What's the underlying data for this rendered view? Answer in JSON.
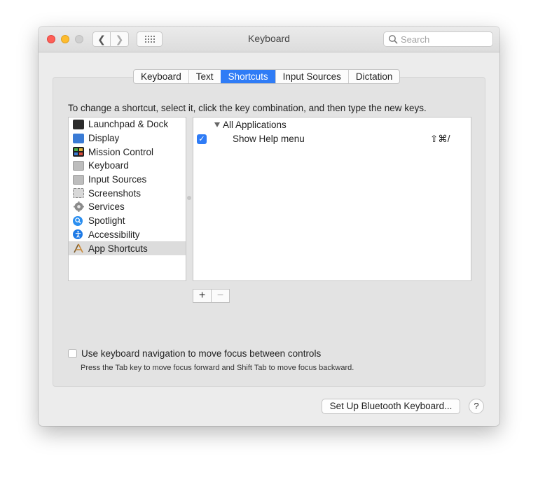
{
  "window": {
    "title": "Keyboard"
  },
  "toolbar": {
    "back_glyph": "❮",
    "forward_glyph": "❯",
    "search_placeholder": "Search"
  },
  "tabs": [
    {
      "label": "Keyboard",
      "active": false
    },
    {
      "label": "Text",
      "active": false
    },
    {
      "label": "Shortcuts",
      "active": true
    },
    {
      "label": "Input Sources",
      "active": false
    },
    {
      "label": "Dictation",
      "active": false
    }
  ],
  "instructions": "To change a shortcut, select it, click the key combination, and then type the new keys.",
  "categories": [
    {
      "label": "Launchpad & Dock",
      "icon": "launchpad-dock-icon",
      "color": "#2b2b2b"
    },
    {
      "label": "Display",
      "icon": "display-icon",
      "color": "#3a7bd5"
    },
    {
      "label": "Mission Control",
      "icon": "mission-control-icon",
      "color": "#1f1f1f"
    },
    {
      "label": "Keyboard",
      "icon": "keyboard-icon",
      "color": "#bdbdbd"
    },
    {
      "label": "Input Sources",
      "icon": "input-sources-icon",
      "color": "#bdbdbd"
    },
    {
      "label": "Screenshots",
      "icon": "screenshots-icon",
      "color": "#d8d8d8"
    },
    {
      "label": "Services",
      "icon": "services-gear-icon",
      "color": "#8a8a8a"
    },
    {
      "label": "Spotlight",
      "icon": "spotlight-icon",
      "color": "#2a8ef0"
    },
    {
      "label": "Accessibility",
      "icon": "accessibility-icon",
      "color": "#1e7ae6"
    },
    {
      "label": "App Shortcuts",
      "icon": "app-shortcuts-icon",
      "color": "#c98a3a",
      "selected": true
    }
  ],
  "shortcuts": {
    "group": "All Applications",
    "items": [
      {
        "label": "Show Help menu",
        "keys": "⇧⌘/",
        "enabled": true
      }
    ]
  },
  "list_buttons": {
    "add": "+",
    "remove": "−"
  },
  "keyboard_navigation": {
    "label": "Use keyboard navigation to move focus between controls",
    "hint": "Press the Tab key to move focus forward and Shift Tab to move focus backward.",
    "checked": false
  },
  "footer": {
    "bluetooth_button": "Set Up Bluetooth Keyboard...",
    "help_button": "?"
  }
}
